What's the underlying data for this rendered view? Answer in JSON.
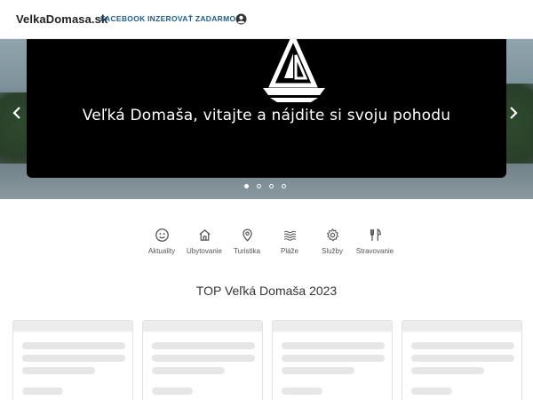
{
  "header": {
    "logo": "VelkaDomasa.sk",
    "nav": [
      {
        "label": "FACEBOOK"
      },
      {
        "label": "INZEROVAŤ ZADARMO"
      }
    ],
    "user_icon": "account-circle-icon"
  },
  "hero": {
    "title": "Veľká Domaša, vitajte a nájdite si svoju pohodu",
    "logo_icon": "sailboat-logo-icon",
    "prev_icon": "chevron-left-icon",
    "next_icon": "chevron-right-icon",
    "slides": 4,
    "active_slide": 1
  },
  "categories": [
    {
      "label": "Aktuality",
      "icon": "smiley-icon"
    },
    {
      "label": "Ubytovanie",
      "icon": "home-icon"
    },
    {
      "label": "Turistika",
      "icon": "map-pin-icon"
    },
    {
      "label": "Pláže",
      "icon": "waves-icon"
    },
    {
      "label": "Služby",
      "icon": "gear-icon"
    },
    {
      "label": "Stravovanie",
      "icon": "cutlery-icon"
    }
  ],
  "section": {
    "title": "TOP Veľká Domaša 2023"
  },
  "cards_loading": 4,
  "colors": {
    "nav_link": "#1f5d8c",
    "hero_panel": "#000000",
    "skeleton": "#e6e6e6"
  }
}
